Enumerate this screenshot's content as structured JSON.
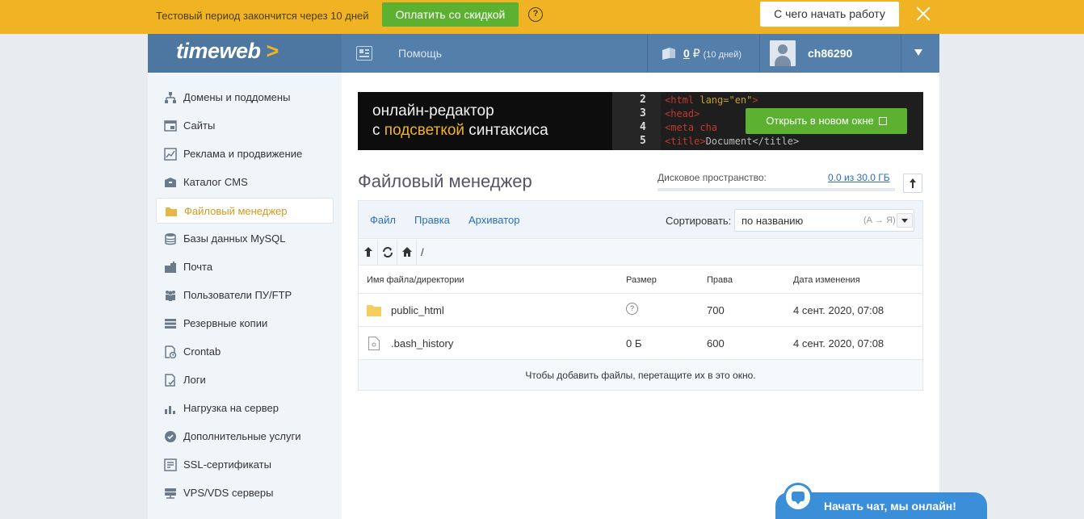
{
  "trial": {
    "text": "Тестовый период закончится через 10 дней",
    "pay_button": "Оплатить со скидкой",
    "help_glyph": "?",
    "start_button": "С чего начать работу"
  },
  "header": {
    "logo": "timeweb",
    "logo_arrow": ">",
    "help": "Помощь",
    "balance_amount": "0",
    "currency": "₽",
    "balance_days": "(10 дней)",
    "username": "ch86290"
  },
  "sidebar": {
    "items": [
      {
        "label": "Домены и поддомены",
        "icon": "sitemap-icon"
      },
      {
        "label": "Сайты",
        "icon": "browser-icon"
      },
      {
        "label": "Реклама и продвижение",
        "icon": "chart-line-icon"
      },
      {
        "label": "Каталог CMS",
        "icon": "box-icon"
      },
      {
        "label": "Файловый менеджер",
        "icon": "folder-icon",
        "active": true
      },
      {
        "label": "Базы данных MySQL",
        "icon": "database-icon"
      },
      {
        "label": "Почта",
        "icon": "mailbox-icon"
      },
      {
        "label": "Пользователи ПУ/FTP",
        "icon": "users-icon"
      },
      {
        "label": "Резервные копии",
        "icon": "server-icon"
      },
      {
        "label": "Crontab",
        "icon": "clock-doc-icon"
      },
      {
        "label": "Логи",
        "icon": "log-icon"
      },
      {
        "label": "Нагрузка на сервер",
        "icon": "bar-chart-icon"
      },
      {
        "label": "Дополнительные услуги",
        "icon": "badge-icon"
      },
      {
        "label": "SSL-сертификаты",
        "icon": "certificate-icon"
      },
      {
        "label": "VPS/VDS серверы",
        "icon": "vps-icon"
      }
    ]
  },
  "banner": {
    "line1": "онлайн-редактор",
    "line2_pre": "с ",
    "line2_hl": "подсветкой",
    "line2_post": " синтаксиса",
    "code_numbers": [
      "2",
      "3",
      "4",
      "5"
    ],
    "code_lines": [
      {
        "tag": "<html ",
        "attr": "lang=\"en\"",
        "rest": ">"
      },
      {
        "tag": "<head>",
        "attr": "",
        "rest": ""
      },
      {
        "tag": "    <meta cha",
        "attr": "",
        "rest": ""
      },
      {
        "tag": "    <title>",
        "attr": "",
        "rest": "Document</title>"
      }
    ],
    "open_button": "Открыть в новом окне"
  },
  "page": {
    "title": "Файловый менеджер",
    "disk_label": "Дисковое пространство:",
    "disk_value": "0.0 из 30.0 ГБ",
    "disk_used_fraction": 0.0
  },
  "fm": {
    "menu": [
      "Файл",
      "Правка",
      "Архиватор"
    ],
    "sort_label": "Сортировать:",
    "sort_value": "по названию",
    "sort_dir": "(А → Я)",
    "path": "/",
    "columns": [
      "Имя файла/директории",
      "Размер",
      "Права",
      "Дата изменения"
    ],
    "rows": [
      {
        "name": "public_html",
        "type": "folder",
        "size": "",
        "size_unknown": "?",
        "perms": "700",
        "date": "4 сент. 2020, 07:08"
      },
      {
        "name": ".bash_history",
        "type": "file",
        "size": "0 Б",
        "size_unknown": "",
        "perms": "600",
        "date": "4 сент. 2020, 07:08"
      }
    ],
    "drop_hint": "Чтобы добавить файлы, перетащите их в это окно."
  },
  "chat": {
    "text": "Начать чат, мы онлайн!"
  },
  "colors": {
    "trial_bar": "#f0b323",
    "accent_green": "#5cb130",
    "nav_blue": "#557fab",
    "link_blue": "#2a6ebb",
    "chat_blue": "#3b8fd8"
  }
}
